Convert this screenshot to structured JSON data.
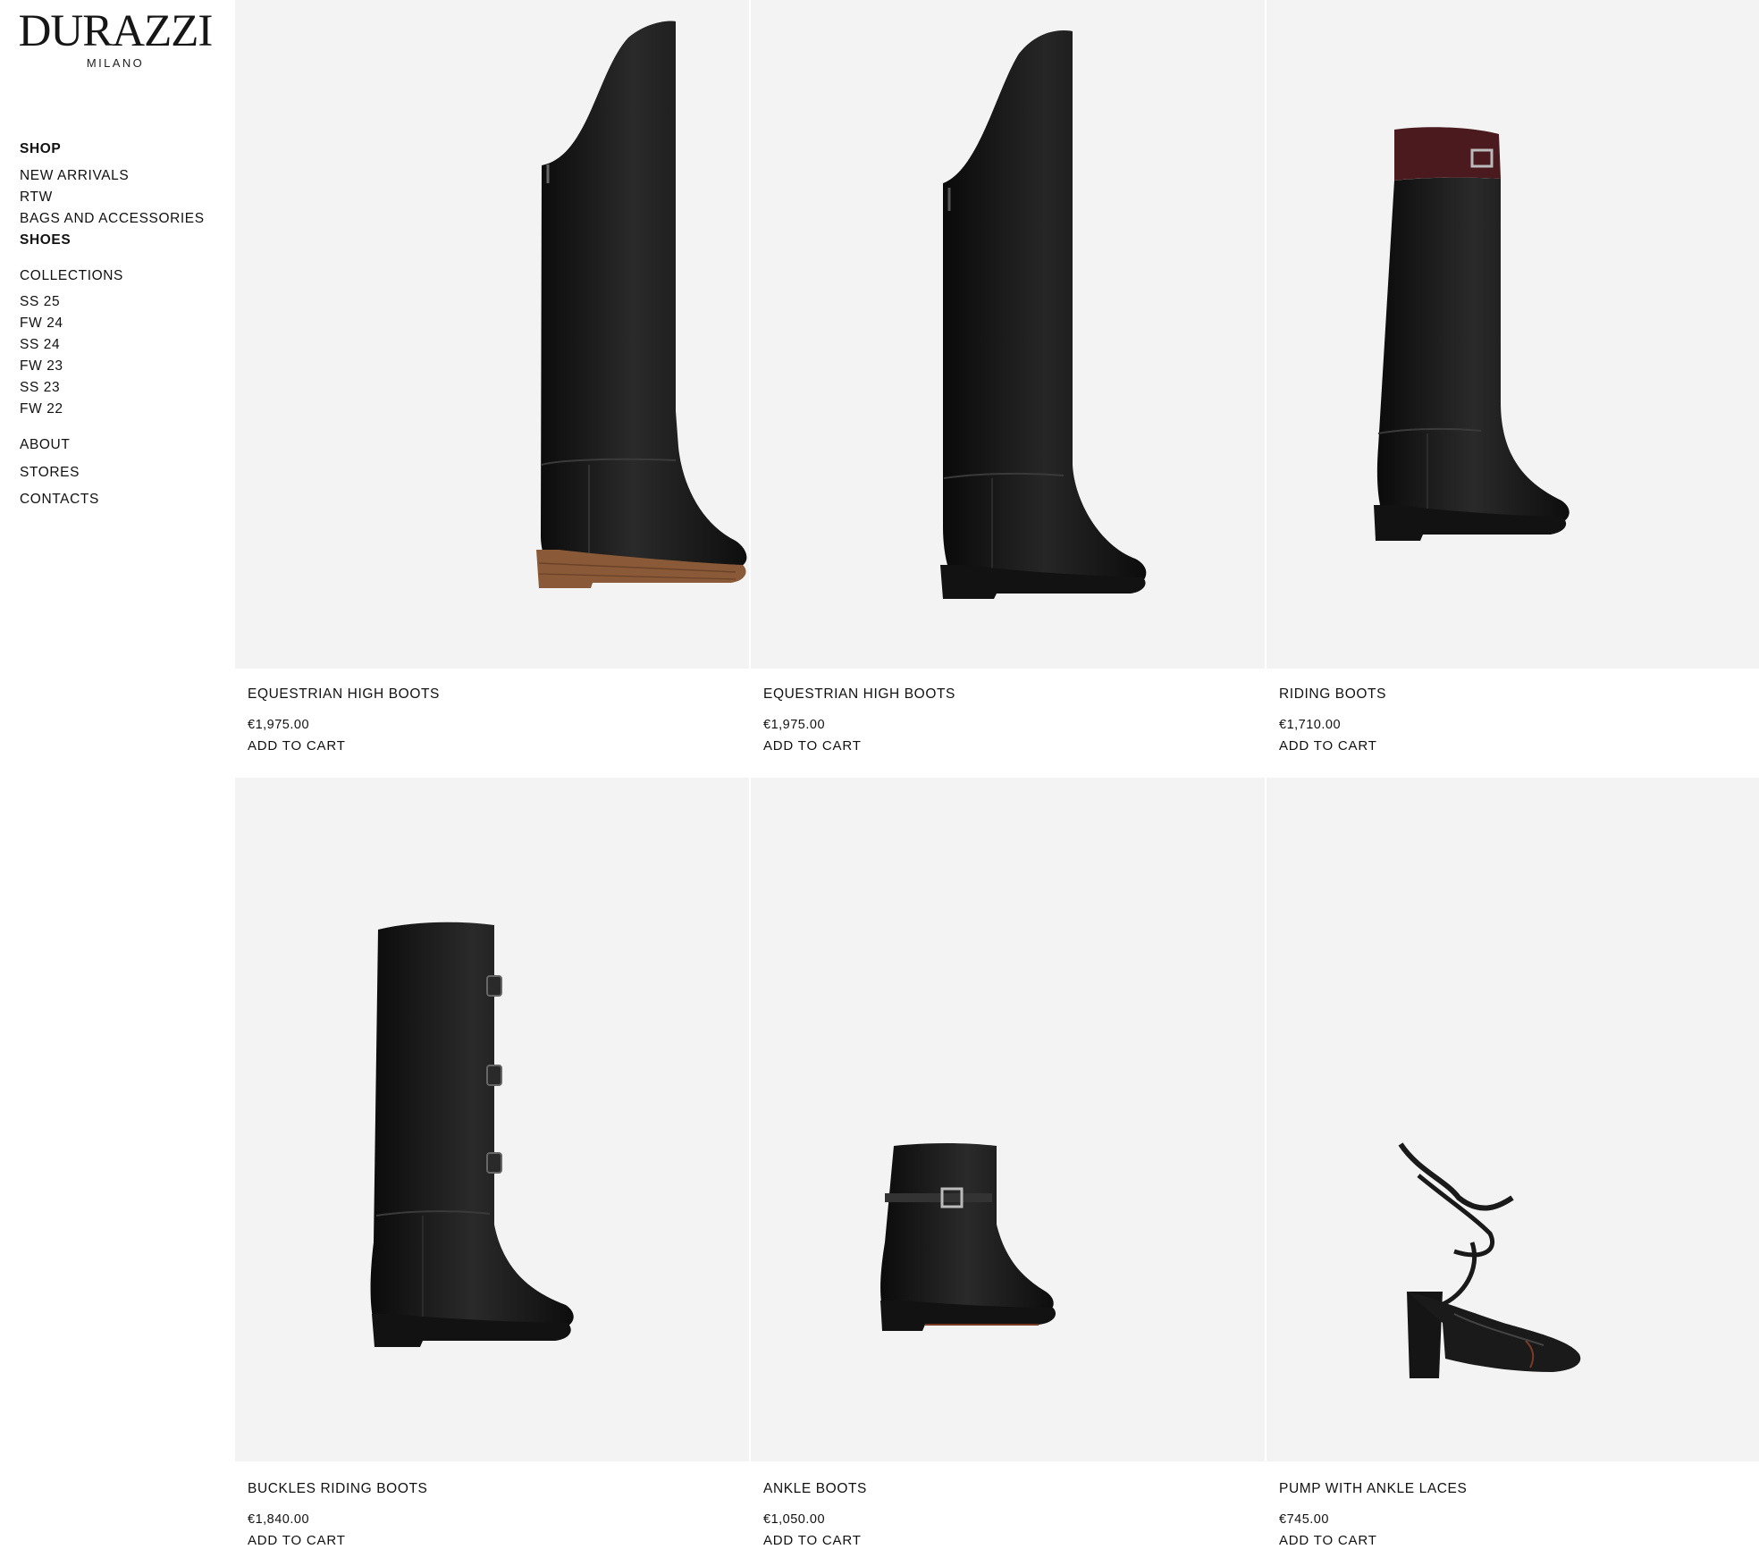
{
  "brand": {
    "name": "DURAZZI",
    "city": "MILANO"
  },
  "nav": {
    "shop": "SHOP",
    "new_arrivals": "NEW ARRIVALS",
    "rtw": "RTW",
    "bags": "BAGS AND ACCESSORIES",
    "shoes": "SHOES",
    "collections": "COLLECTIONS",
    "ss25": "SS 25",
    "fw24": "FW 24",
    "ss24": "SS 24",
    "fw23": "FW 23",
    "ss23": "SS 23",
    "fw22": "FW 22",
    "about": "ABOUT",
    "stores": "STORES",
    "contacts": "CONTACTS"
  },
  "products": [
    {
      "name": "EQUESTRIAN HIGH BOOTS",
      "price": "€1,975.00",
      "cta": "ADD TO CART",
      "image": "boot-tall-wood-sole"
    },
    {
      "name": "EQUESTRIAN HIGH BOOTS",
      "price": "€1,975.00",
      "cta": "ADD TO CART",
      "image": "boot-tall-black-sole"
    },
    {
      "name": "RIDING BOOTS",
      "price": "€1,710.00",
      "cta": "ADD TO CART",
      "image": "boot-riding-burgundy-cuff"
    },
    {
      "name": "BUCKLES RIDING BOOTS",
      "price": "€1,840.00",
      "cta": "ADD TO CART",
      "image": "boot-buckles"
    },
    {
      "name": "ANKLE BOOTS",
      "price": "€1,050.00",
      "cta": "ADD TO CART",
      "image": "ankle-boot"
    },
    {
      "name": "PUMP WITH ANKLE LACES",
      "price": "€745.00",
      "cta": "ADD TO CART",
      "image": "pump-laces"
    }
  ],
  "colors": {
    "tile_bg": "#f3f3f3",
    "leather": "#141414",
    "burgundy": "#4a1a1e",
    "wood_sole": "#8a5a38"
  }
}
